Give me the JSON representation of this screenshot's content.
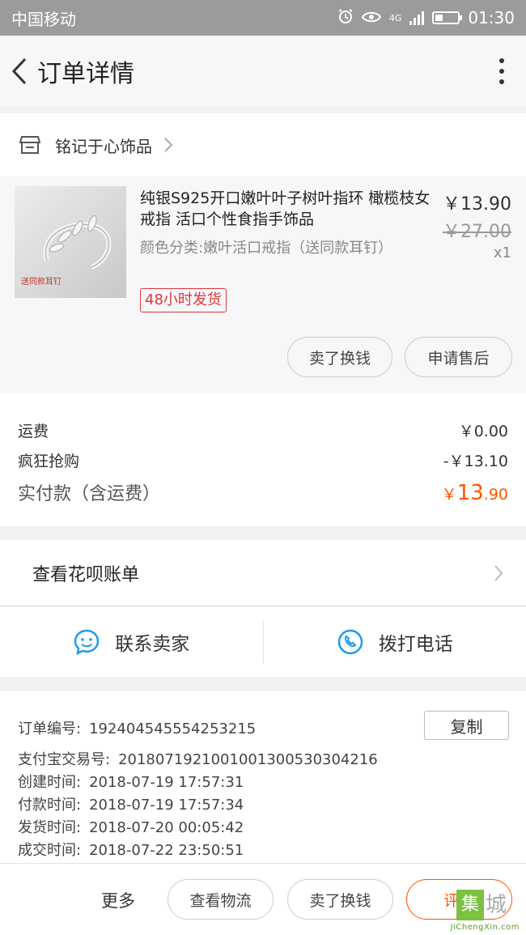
{
  "status_bar": {
    "carrier": "中国移动",
    "network": "4G",
    "time": "01:30",
    "battery_level": 0.3
  },
  "navbar": {
    "title": "订单详情",
    "back_icon": "chevron-left-icon",
    "more_icon": "more-vertical-icon"
  },
  "shop": {
    "name": "铭记于心饰品",
    "icon": "store-icon"
  },
  "product": {
    "title": "纯银S925开口嫩叶叶子树叶指环 橄榄枝女戒指 活口个性食指手饰品",
    "variant": "颜色分类:嫩叶活口戒指（送同款耳钉）",
    "badge": "48小时发货",
    "price": "￥13.90",
    "original_price": "￥27.00",
    "quantity": "x1",
    "image_tag": "送同款耳钉",
    "actions": {
      "sell": "卖了换钱",
      "after_sale": "申请售后"
    }
  },
  "costs": {
    "shipping_label": "运费",
    "shipping_value": "￥0.00",
    "discount_label": "疯狂抢购",
    "discount_value": "-￥13.10",
    "total_label": "实付款（含运费）",
    "total_currency": "￥",
    "total_int": "13",
    "total_dec": ".90"
  },
  "huabei": {
    "label": "查看花呗账单"
  },
  "contact": {
    "seller": "联系卖家",
    "phone": "拨打电话"
  },
  "order_info": {
    "order_no_label": "订单编号:",
    "order_no": "192404545554253215",
    "copy": "复制",
    "alipay_label": "支付宝交易号:",
    "alipay_no": "2018071921001001300530304216",
    "created_label": "创建时间:",
    "created": "2018-07-19 17:57:31",
    "paid_label": "付款时间:",
    "paid": "2018-07-19 17:57:34",
    "shipped_label": "发货时间:",
    "shipped": "2018-07-20 00:05:42",
    "completed_label": "成交时间:",
    "completed": "2018-07-22 23:50:51"
  },
  "bottom_bar": {
    "more": "更多",
    "logistics": "查看物流",
    "sell": "卖了换钱",
    "review": "评价"
  },
  "watermark": {
    "logo_char": "集",
    "name": "城",
    "url": "JiChengXin.com"
  },
  "colors": {
    "accent": "#ff5500",
    "badge_red": "#e0363a",
    "contact_blue": "#1e9be8",
    "status_bar": "#9b9b9b"
  }
}
